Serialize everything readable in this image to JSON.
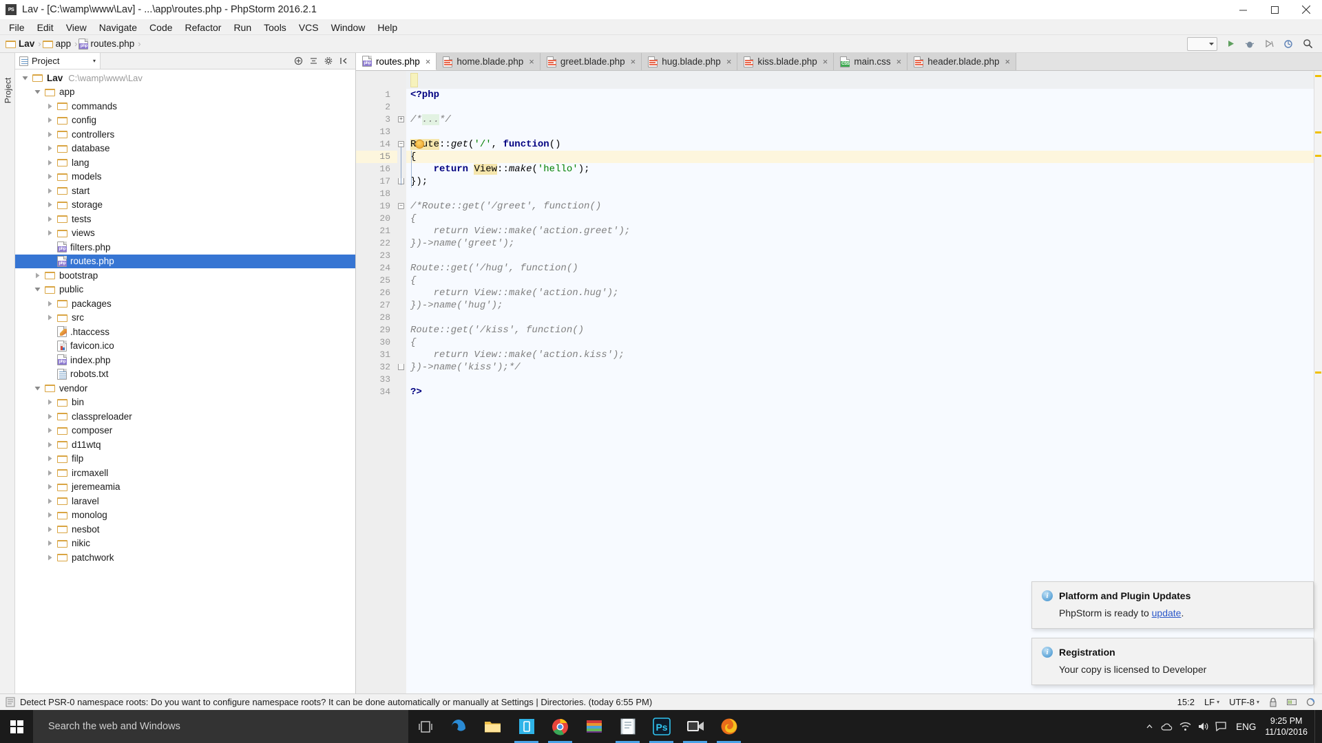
{
  "window": {
    "title": "Lav - [C:\\wamp\\www\\Lav] - ...\\app\\routes.php - PhpStorm 2016.2.1",
    "app_icon": "PS",
    "minimize": "minimize-button",
    "maximize": "maximize-button",
    "close": "close-button"
  },
  "menu": {
    "items": [
      "File",
      "Edit",
      "View",
      "Navigate",
      "Code",
      "Refactor",
      "Run",
      "Tools",
      "VCS",
      "Window",
      "Help"
    ]
  },
  "navbar": {
    "breadcrumbs": [
      {
        "label": "Lav",
        "icon": "folder-icon",
        "bold": true
      },
      {
        "label": "app",
        "icon": "folder-icon",
        "bold": false
      },
      {
        "label": "routes.php",
        "icon": "php-file-icon",
        "bold": false
      }
    ],
    "separator": "›",
    "run_config": "",
    "buttons": [
      "run-button",
      "debug-button",
      "coverage-button",
      "update-project-button",
      "search-everywhere-button"
    ]
  },
  "left_rail": {
    "label": "Project"
  },
  "project_panel": {
    "tab_label": "Project",
    "tab_caret": "▾",
    "header_icons": [
      "collapse-all-icon",
      "expand-all-icon",
      "settings-icon",
      "hide-icon"
    ],
    "tree": [
      {
        "depth": 0,
        "label": "Lav",
        "path": "C:\\wamp\\www\\Lav",
        "icon": "folder",
        "state": "open",
        "bold": true,
        "selected": false
      },
      {
        "depth": 1,
        "label": "app",
        "path": "",
        "icon": "folder",
        "state": "open",
        "bold": false,
        "selected": false
      },
      {
        "depth": 2,
        "label": "commands",
        "path": "",
        "icon": "folder",
        "state": "closed",
        "bold": false,
        "selected": false
      },
      {
        "depth": 2,
        "label": "config",
        "path": "",
        "icon": "folder",
        "state": "closed",
        "bold": false,
        "selected": false
      },
      {
        "depth": 2,
        "label": "controllers",
        "path": "",
        "icon": "folder",
        "state": "closed",
        "bold": false,
        "selected": false
      },
      {
        "depth": 2,
        "label": "database",
        "path": "",
        "icon": "folder",
        "state": "closed",
        "bold": false,
        "selected": false
      },
      {
        "depth": 2,
        "label": "lang",
        "path": "",
        "icon": "folder",
        "state": "closed",
        "bold": false,
        "selected": false
      },
      {
        "depth": 2,
        "label": "models",
        "path": "",
        "icon": "folder",
        "state": "closed",
        "bold": false,
        "selected": false
      },
      {
        "depth": 2,
        "label": "start",
        "path": "",
        "icon": "folder",
        "state": "closed",
        "bold": false,
        "selected": false
      },
      {
        "depth": 2,
        "label": "storage",
        "path": "",
        "icon": "folder",
        "state": "closed",
        "bold": false,
        "selected": false
      },
      {
        "depth": 2,
        "label": "tests",
        "path": "",
        "icon": "folder",
        "state": "closed",
        "bold": false,
        "selected": false
      },
      {
        "depth": 2,
        "label": "views",
        "path": "",
        "icon": "folder",
        "state": "closed",
        "bold": false,
        "selected": false
      },
      {
        "depth": 2,
        "label": "filters.php",
        "path": "",
        "icon": "php",
        "state": "leaf",
        "bold": false,
        "selected": false
      },
      {
        "depth": 2,
        "label": "routes.php",
        "path": "",
        "icon": "php",
        "state": "leaf",
        "bold": false,
        "selected": true
      },
      {
        "depth": 1,
        "label": "bootstrap",
        "path": "",
        "icon": "folder",
        "state": "closed",
        "bold": false,
        "selected": false
      },
      {
        "depth": 1,
        "label": "public",
        "path": "",
        "icon": "folder",
        "state": "open",
        "bold": false,
        "selected": false
      },
      {
        "depth": 2,
        "label": "packages",
        "path": "",
        "icon": "folder",
        "state": "closed",
        "bold": false,
        "selected": false
      },
      {
        "depth": 2,
        "label": "src",
        "path": "",
        "icon": "folder",
        "state": "closed",
        "bold": false,
        "selected": false
      },
      {
        "depth": 2,
        "label": ".htaccess",
        "path": "",
        "icon": "htaccess",
        "state": "leaf",
        "bold": false,
        "selected": false
      },
      {
        "depth": 2,
        "label": "favicon.ico",
        "path": "",
        "icon": "image",
        "state": "leaf",
        "bold": false,
        "selected": false
      },
      {
        "depth": 2,
        "label": "index.php",
        "path": "",
        "icon": "php",
        "state": "leaf",
        "bold": false,
        "selected": false
      },
      {
        "depth": 2,
        "label": "robots.txt",
        "path": "",
        "icon": "text",
        "state": "leaf",
        "bold": false,
        "selected": false
      },
      {
        "depth": 1,
        "label": "vendor",
        "path": "",
        "icon": "folder",
        "state": "open",
        "bold": false,
        "selected": false
      },
      {
        "depth": 2,
        "label": "bin",
        "path": "",
        "icon": "folder",
        "state": "closed",
        "bold": false,
        "selected": false
      },
      {
        "depth": 2,
        "label": "classpreloader",
        "path": "",
        "icon": "folder",
        "state": "closed",
        "bold": false,
        "selected": false
      },
      {
        "depth": 2,
        "label": "composer",
        "path": "",
        "icon": "folder",
        "state": "closed",
        "bold": false,
        "selected": false
      },
      {
        "depth": 2,
        "label": "d11wtq",
        "path": "",
        "icon": "folder",
        "state": "closed",
        "bold": false,
        "selected": false
      },
      {
        "depth": 2,
        "label": "filp",
        "path": "",
        "icon": "folder",
        "state": "closed",
        "bold": false,
        "selected": false
      },
      {
        "depth": 2,
        "label": "ircmaxell",
        "path": "",
        "icon": "folder",
        "state": "closed",
        "bold": false,
        "selected": false
      },
      {
        "depth": 2,
        "label": "jeremeamia",
        "path": "",
        "icon": "folder",
        "state": "closed",
        "bold": false,
        "selected": false
      },
      {
        "depth": 2,
        "label": "laravel",
        "path": "",
        "icon": "folder",
        "state": "closed",
        "bold": false,
        "selected": false
      },
      {
        "depth": 2,
        "label": "monolog",
        "path": "",
        "icon": "folder",
        "state": "closed",
        "bold": false,
        "selected": false
      },
      {
        "depth": 2,
        "label": "nesbot",
        "path": "",
        "icon": "folder",
        "state": "closed",
        "bold": false,
        "selected": false
      },
      {
        "depth": 2,
        "label": "nikic",
        "path": "",
        "icon": "folder",
        "state": "closed",
        "bold": false,
        "selected": false
      },
      {
        "depth": 2,
        "label": "patchwork",
        "path": "",
        "icon": "folder",
        "state": "closed",
        "bold": false,
        "selected": false
      }
    ]
  },
  "editor": {
    "tabs": [
      {
        "label": "routes.php",
        "icon": "php",
        "active": true,
        "close": "×"
      },
      {
        "label": "home.blade.php",
        "icon": "blade",
        "active": false,
        "close": "×"
      },
      {
        "label": "greet.blade.php",
        "icon": "blade",
        "active": false,
        "close": "×"
      },
      {
        "label": "hug.blade.php",
        "icon": "blade",
        "active": false,
        "close": "×"
      },
      {
        "label": "kiss.blade.php",
        "icon": "blade",
        "active": false,
        "close": "×"
      },
      {
        "label": "main.css",
        "icon": "css",
        "active": false,
        "close": "×"
      },
      {
        "label": "header.blade.php",
        "icon": "blade",
        "active": false,
        "close": "×"
      }
    ],
    "line_numbers": [
      1,
      2,
      3,
      13,
      14,
      15,
      16,
      17,
      18,
      19,
      20,
      21,
      22,
      23,
      24,
      25,
      26,
      27,
      28,
      29,
      30,
      31,
      32,
      33,
      34
    ],
    "current_line_index": 5,
    "code_lines": [
      {
        "n": 1,
        "text": "<?php",
        "kind": "php-open"
      },
      {
        "n": 2,
        "text": "",
        "kind": "blank"
      },
      {
        "n": 3,
        "text": "/*...*/",
        "kind": "folded-comment"
      },
      {
        "n": 13,
        "text": "",
        "kind": "blank"
      },
      {
        "n": 14,
        "text": "Route::get('/', function()",
        "kind": "code-route"
      },
      {
        "n": 15,
        "text": "{",
        "kind": "code-plain"
      },
      {
        "n": 16,
        "text": "    return View::make('hello');",
        "kind": "code-return"
      },
      {
        "n": 17,
        "text": "});",
        "kind": "code-plain"
      },
      {
        "n": 18,
        "text": "",
        "kind": "blank"
      },
      {
        "n": 19,
        "text": "/*Route::get('/greet', function()",
        "kind": "comment"
      },
      {
        "n": 20,
        "text": "{",
        "kind": "comment"
      },
      {
        "n": 21,
        "text": "    return View::make('action.greet');",
        "kind": "comment"
      },
      {
        "n": 22,
        "text": "})->name('greet');",
        "kind": "comment"
      },
      {
        "n": 23,
        "text": "",
        "kind": "blank"
      },
      {
        "n": 24,
        "text": "Route::get('/hug', function()",
        "kind": "comment"
      },
      {
        "n": 25,
        "text": "{",
        "kind": "comment"
      },
      {
        "n": 26,
        "text": "    return View::make('action.hug');",
        "kind": "comment"
      },
      {
        "n": 27,
        "text": "})->name('hug');",
        "kind": "comment"
      },
      {
        "n": 28,
        "text": "",
        "kind": "blank"
      },
      {
        "n": 29,
        "text": "Route::get('/kiss', function()",
        "kind": "comment"
      },
      {
        "n": 30,
        "text": "{",
        "kind": "comment"
      },
      {
        "n": 31,
        "text": "    return View::make('action.kiss');",
        "kind": "comment"
      },
      {
        "n": 32,
        "text": "})->name('kiss');*/",
        "kind": "comment"
      },
      {
        "n": 33,
        "text": "",
        "kind": "blank"
      },
      {
        "n": 34,
        "text": "?>",
        "kind": "php-close"
      }
    ],
    "highlighted_identifiers": [
      "Route",
      "View"
    ],
    "intention_bulb": "lightbulb-icon"
  },
  "notifications": [
    {
      "icon": "info-icon",
      "title": "Platform and Plugin Updates",
      "body_before": "PhpStorm is ready to ",
      "link": "update",
      "body_after": "."
    },
    {
      "icon": "info-icon",
      "title": "Registration",
      "body_before": "Your copy is licensed to Developer",
      "link": "",
      "body_after": ""
    }
  ],
  "statusbar": {
    "message": "Detect PSR-0 namespace roots: Do you want to configure namespace roots? It can be done automatically or manually at Settings | Directories. (today 6:55 PM)",
    "caret_position": "15:2",
    "line_separator": "LF",
    "encoding": "UTF-8",
    "icons": [
      "event-log-icon",
      "lock-icon",
      "memory-icon",
      "background-tasks-icon"
    ]
  },
  "taskbar": {
    "start": "windows-start-icon",
    "search_placeholder": "Search the web and Windows",
    "apps": [
      {
        "name": "task-view-icon",
        "running": false
      },
      {
        "name": "edge-icon",
        "running": false
      },
      {
        "name": "file-explorer-icon",
        "running": false
      },
      {
        "name": "phone-companion-icon",
        "running": true
      },
      {
        "name": "chrome-icon",
        "running": true
      },
      {
        "name": "winrar-icon",
        "running": false
      },
      {
        "name": "notepad-icon",
        "running": true
      },
      {
        "name": "photoshop-icon",
        "running": true
      },
      {
        "name": "camtasia-icon",
        "running": true
      },
      {
        "name": "firefox-icon",
        "running": true
      }
    ],
    "tray": {
      "chevron": "show-hidden-icons",
      "onedrive": "onedrive-icon",
      "network": "network-icon",
      "volume": "volume-icon",
      "action_center": "action-center-icon",
      "language": "ENG",
      "time": "9:25 PM",
      "date": "11/10/2016"
    }
  }
}
